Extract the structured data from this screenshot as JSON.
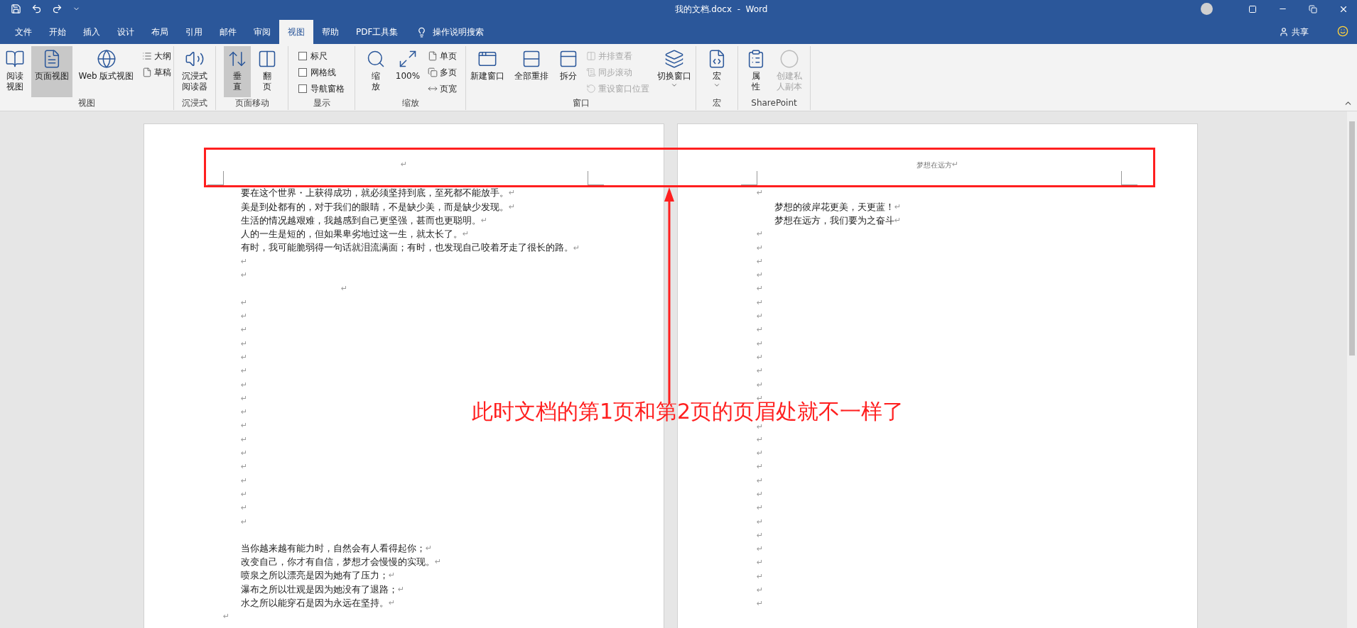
{
  "title_bar": {
    "title": "我的文档.docx  -  Word"
  },
  "tabs": [
    {
      "label": "文件",
      "selected": false
    },
    {
      "label": "开始",
      "selected": false
    },
    {
      "label": "插入",
      "selected": false
    },
    {
      "label": "设计",
      "selected": false
    },
    {
      "label": "布局",
      "selected": false
    },
    {
      "label": "引用",
      "selected": false
    },
    {
      "label": "邮件",
      "selected": false
    },
    {
      "label": "审阅",
      "selected": false
    },
    {
      "label": "视图",
      "selected": true
    },
    {
      "label": "帮助",
      "selected": false
    },
    {
      "label": "PDF工具集",
      "selected": false
    }
  ],
  "tell_me": "操作说明搜索",
  "share": "共享",
  "ribbon": {
    "groups": [
      {
        "label": "视图",
        "items": [
          {
            "kind": "large",
            "label": "阅读视图",
            "selected": false
          },
          {
            "kind": "large",
            "label": "页面视图",
            "selected": true
          },
          {
            "kind": "large",
            "label": "Web 版式视图",
            "selected": false
          },
          {
            "kind": "small",
            "label": "大纲",
            "selected": false
          },
          {
            "kind": "small",
            "label": "草稿",
            "selected": false
          }
        ]
      },
      {
        "label": "沉浸式",
        "items": [
          {
            "kind": "large",
            "label": "沉浸式阅读器"
          }
        ]
      },
      {
        "label": "页面移动",
        "items": [
          {
            "kind": "large",
            "label": "垂直",
            "selected": true
          },
          {
            "kind": "large",
            "label": "翻页",
            "selected": false
          }
        ]
      },
      {
        "label": "显示",
        "items": [
          {
            "kind": "checkbox",
            "label": "标尺",
            "checked": false
          },
          {
            "kind": "checkbox",
            "label": "网格线",
            "checked": false
          },
          {
            "kind": "checkbox",
            "label": "导航窗格",
            "checked": false
          }
        ]
      },
      {
        "label": "缩放",
        "items": [
          {
            "kind": "large",
            "label": "缩放"
          },
          {
            "kind": "large",
            "label": "100%"
          },
          {
            "kind": "small",
            "label": "单页"
          },
          {
            "kind": "small",
            "label": "多页"
          },
          {
            "kind": "small",
            "label": "页宽"
          }
        ]
      },
      {
        "label": "窗口",
        "items": [
          {
            "kind": "large",
            "label": "新建窗口",
            "disabled": false
          },
          {
            "kind": "large",
            "label": "全部重排",
            "disabled": false
          },
          {
            "kind": "large",
            "label": "拆分",
            "disabled": false
          },
          {
            "kind": "small",
            "label": "并排查看",
            "disabled": true
          },
          {
            "kind": "small",
            "label": "同步滚动",
            "disabled": true
          },
          {
            "kind": "small",
            "label": "重设窗口位置",
            "disabled": true
          },
          {
            "kind": "menu",
            "label": "切换窗口",
            "disabled": false
          }
        ]
      },
      {
        "label": "宏",
        "items": [
          {
            "kind": "menu",
            "label": "宏"
          }
        ]
      },
      {
        "label": "SharePoint",
        "items": [
          {
            "kind": "large",
            "label": "属性",
            "disabled": false
          },
          {
            "kind": "large",
            "label": "创建私人副本",
            "disabled": true
          }
        ]
      }
    ]
  },
  "pages": [
    {
      "header": {
        "mark": "↵"
      },
      "paragraphs": [
        {
          "kind": "text",
          "text": "要在这个世界・上获得成功，就必须坚持到底，至死都不能放手。",
          "mark": "↵"
        },
        {
          "kind": "text",
          "text": "美是到处都有的，对于我们的眼睛，不是缺少美，而是缺少发现。",
          "mark": "↵"
        },
        {
          "kind": "text",
          "text": "生活的情况越艰难，我越感到自己更坚强，甚而也更聪明。",
          "mark": "↵"
        },
        {
          "kind": "text",
          "text": "人的一生是短的，但如果卑劣地过这一生，就太长了。",
          "mark": "↵"
        },
        {
          "kind": "text",
          "text": "有时，我可能脆弱得一句话就泪流满面；有时，也发现自己咬着牙走了很长的路。",
          "mark": "↵"
        },
        {
          "kind": "empty",
          "mark": "↵"
        },
        {
          "kind": "empty",
          "mark": "↵"
        },
        {
          "kind": "empty_offset",
          "mark": "↵"
        },
        {
          "kind": "empty",
          "mark": "↵"
        },
        {
          "kind": "empty",
          "mark": "↵"
        },
        {
          "kind": "empty",
          "mark": "↵"
        },
        {
          "kind": "empty",
          "mark": "↵"
        },
        {
          "kind": "empty",
          "mark": "↵"
        },
        {
          "kind": "empty",
          "mark": "↵"
        },
        {
          "kind": "empty",
          "mark": "↵"
        },
        {
          "kind": "empty",
          "mark": "↵"
        },
        {
          "kind": "empty",
          "mark": "↵"
        },
        {
          "kind": "empty",
          "mark": "↵"
        },
        {
          "kind": "empty",
          "mark": "↵"
        },
        {
          "kind": "empty",
          "mark": "↵"
        },
        {
          "kind": "empty",
          "mark": "↵"
        },
        {
          "kind": "empty",
          "mark": "↵"
        },
        {
          "kind": "empty",
          "mark": "↵"
        },
        {
          "kind": "empty",
          "mark": "↵"
        },
        {
          "kind": "empty",
          "mark": "↵"
        },
        {
          "kind": "text_spaced",
          "text": "当你越来越有能力时，自然会有人看得起你；",
          "mark": "↵"
        },
        {
          "kind": "text",
          "text": "改变自己，你才有自信，梦想才会慢慢的实现。",
          "mark": "↵"
        },
        {
          "kind": "text",
          "text": "喷泉之所以漂亮是因为她有了压力；",
          "mark": "↵"
        },
        {
          "kind": "text",
          "text": "瀑布之所以壮观是因为她没有了退路；",
          "mark": "↵"
        },
        {
          "kind": "text",
          "text": "水之所以能穿石是因为永远在坚持。",
          "mark": "↵"
        },
        {
          "kind": "empty_outdent",
          "mark": "↵"
        }
      ]
    },
    {
      "header": {
        "text": "梦想在远方",
        "mark": "↵"
      },
      "paragraphs": [
        {
          "kind": "empty_outdent",
          "mark": "↵"
        },
        {
          "kind": "text",
          "text": "梦想的彼岸花更美，天更蓝！",
          "mark": "↵"
        },
        {
          "kind": "text",
          "text": "梦想在远方，我们要为之奋斗",
          "mark": "↵"
        },
        {
          "kind": "empty_outdent",
          "mark": "↵"
        },
        {
          "kind": "empty_outdent",
          "mark": "↵"
        },
        {
          "kind": "empty_outdent",
          "mark": "↵"
        },
        {
          "kind": "empty_outdent",
          "mark": "↵"
        },
        {
          "kind": "empty_outdent",
          "mark": "↵"
        },
        {
          "kind": "empty_outdent",
          "mark": "↵"
        },
        {
          "kind": "empty_outdent",
          "mark": "↵"
        },
        {
          "kind": "empty_outdent",
          "mark": "↵"
        },
        {
          "kind": "empty_outdent",
          "mark": "↵"
        },
        {
          "kind": "empty_outdent",
          "mark": "↵"
        },
        {
          "kind": "empty_outdent",
          "mark": "↵"
        },
        {
          "kind": "empty_outdent",
          "mark": "↵"
        },
        {
          "kind": "empty_outdent",
          "mark": "↵"
        },
        {
          "kind": "empty_outdent_spaced",
          "mark": "↵"
        },
        {
          "kind": "empty_outdent",
          "mark": "↵"
        },
        {
          "kind": "empty_outdent",
          "mark": "↵"
        },
        {
          "kind": "empty_outdent",
          "mark": "↵"
        },
        {
          "kind": "empty_outdent",
          "mark": "↵"
        },
        {
          "kind": "empty_outdent",
          "mark": "↵"
        },
        {
          "kind": "empty_outdent",
          "mark": "↵"
        },
        {
          "kind": "empty_outdent",
          "mark": "↵"
        },
        {
          "kind": "empty_outdent",
          "mark": "↵"
        },
        {
          "kind": "empty_outdent",
          "mark": "↵"
        },
        {
          "kind": "empty_outdent",
          "mark": "↵"
        },
        {
          "kind": "empty_outdent",
          "mark": "↵"
        },
        {
          "kind": "empty_outdent",
          "mark": "↵"
        },
        {
          "kind": "empty_outdent",
          "mark": "↵"
        }
      ]
    }
  ],
  "annotation": {
    "text": "此时文档的第1页和第2页的页眉处就不一样了"
  }
}
